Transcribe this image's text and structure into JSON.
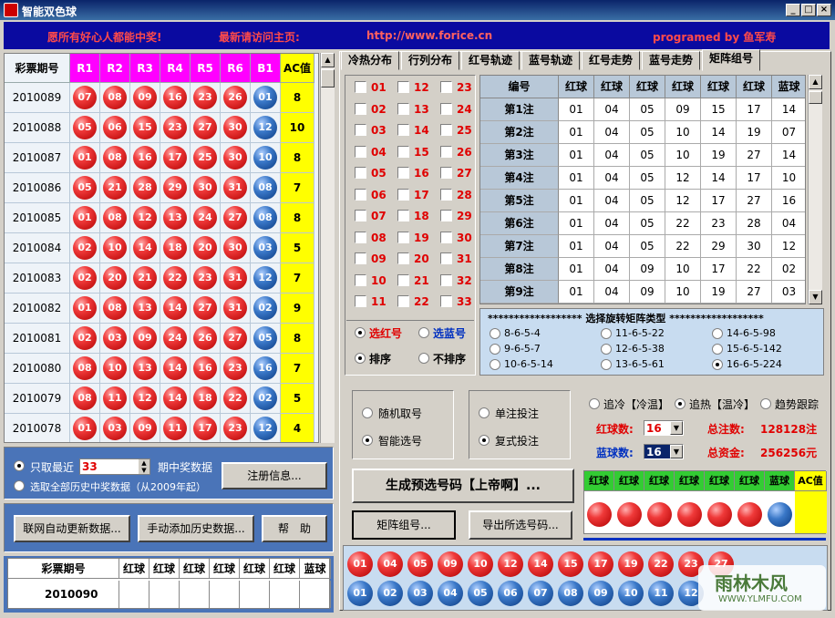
{
  "window": {
    "title": "智能双色球"
  },
  "banner": {
    "msg1": "愿所有好心人都能中奖!",
    "msg2": "最新请访问主页:",
    "url": "http://www.forice.cn",
    "author": "programed by 鱼军寿"
  },
  "history": {
    "headers": [
      "彩票期号",
      "R1",
      "R2",
      "R3",
      "R4",
      "R5",
      "R6",
      "B1",
      "AC值"
    ],
    "rows": [
      {
        "issue": "2010089",
        "reds": [
          "07",
          "08",
          "09",
          "16",
          "23",
          "26"
        ],
        "blue": "01",
        "ac": "8"
      },
      {
        "issue": "2010088",
        "reds": [
          "05",
          "06",
          "15",
          "23",
          "27",
          "30"
        ],
        "blue": "12",
        "ac": "10"
      },
      {
        "issue": "2010087",
        "reds": [
          "01",
          "08",
          "16",
          "17",
          "25",
          "30"
        ],
        "blue": "10",
        "ac": "8"
      },
      {
        "issue": "2010086",
        "reds": [
          "05",
          "21",
          "28",
          "29",
          "30",
          "31"
        ],
        "blue": "08",
        "ac": "7"
      },
      {
        "issue": "2010085",
        "reds": [
          "01",
          "08",
          "12",
          "13",
          "24",
          "27"
        ],
        "blue": "08",
        "ac": "8"
      },
      {
        "issue": "2010084",
        "reds": [
          "02",
          "10",
          "14",
          "18",
          "20",
          "30"
        ],
        "blue": "03",
        "ac": "5"
      },
      {
        "issue": "2010083",
        "reds": [
          "02",
          "20",
          "21",
          "22",
          "23",
          "31"
        ],
        "blue": "12",
        "ac": "7"
      },
      {
        "issue": "2010082",
        "reds": [
          "01",
          "08",
          "13",
          "14",
          "27",
          "31"
        ],
        "blue": "02",
        "ac": "9"
      },
      {
        "issue": "2010081",
        "reds": [
          "02",
          "03",
          "09",
          "24",
          "26",
          "27"
        ],
        "blue": "05",
        "ac": "8"
      },
      {
        "issue": "2010080",
        "reds": [
          "08",
          "10",
          "13",
          "14",
          "16",
          "23"
        ],
        "blue": "16",
        "ac": "7"
      },
      {
        "issue": "2010079",
        "reds": [
          "08",
          "11",
          "12",
          "14",
          "18",
          "22"
        ],
        "blue": "02",
        "ac": "5"
      },
      {
        "issue": "2010078",
        "reds": [
          "01",
          "03",
          "09",
          "11",
          "17",
          "23"
        ],
        "blue": "12",
        "ac": "4"
      }
    ]
  },
  "filter": {
    "recent_label": "只取最近",
    "recent_value": "33",
    "recent_suffix": "期中奖数据",
    "all_label": "选取全部历史中奖数据（从2009年起）",
    "register": "注册信息..."
  },
  "buttons": {
    "auto_update": "联网自动更新数据...",
    "manual_add": "手动添加历史数据...",
    "help": "帮　助",
    "generate": "生成预选号码【上帝啊】...",
    "matrix": "矩阵组号...",
    "export": "导出所选号码..."
  },
  "bottom_table": {
    "headers": [
      "彩票期号",
      "红球",
      "红球",
      "红球",
      "红球",
      "红球",
      "红球",
      "蓝球"
    ],
    "issue": "2010090"
  },
  "tabs": [
    "冷热分布",
    "行列分布",
    "红号轨迹",
    "蓝号轨迹",
    "红号走势",
    "蓝号走势",
    "矩阵组号"
  ],
  "checkbox_numbers": [
    "01",
    "12",
    "23",
    "02",
    "13",
    "24",
    "03",
    "14",
    "25",
    "04",
    "15",
    "26",
    "05",
    "16",
    "27",
    "06",
    "17",
    "28",
    "07",
    "18",
    "29",
    "08",
    "19",
    "30",
    "09",
    "20",
    "31",
    "10",
    "21",
    "32",
    "11",
    "22",
    "33"
  ],
  "select": {
    "red": "选红号",
    "blue": "选蓝号",
    "sort": "排序",
    "nosort": "不排序"
  },
  "matrix_table": {
    "headers": [
      "编号",
      "红球",
      "红球",
      "红球",
      "红球",
      "红球",
      "红球",
      "蓝球"
    ],
    "rows": [
      [
        "第1注",
        "01",
        "04",
        "05",
        "09",
        "15",
        "17",
        "14"
      ],
      [
        "第2注",
        "01",
        "04",
        "05",
        "10",
        "14",
        "19",
        "07"
      ],
      [
        "第3注",
        "01",
        "04",
        "05",
        "10",
        "19",
        "27",
        "14"
      ],
      [
        "第4注",
        "01",
        "04",
        "05",
        "12",
        "14",
        "17",
        "10"
      ],
      [
        "第5注",
        "01",
        "04",
        "05",
        "12",
        "17",
        "27",
        "16"
      ],
      [
        "第6注",
        "01",
        "04",
        "05",
        "22",
        "23",
        "28",
        "04"
      ],
      [
        "第7注",
        "01",
        "04",
        "05",
        "22",
        "29",
        "30",
        "12"
      ],
      [
        "第8注",
        "01",
        "04",
        "09",
        "10",
        "17",
        "22",
        "02"
      ],
      [
        "第9注",
        "01",
        "04",
        "09",
        "10",
        "19",
        "27",
        "03"
      ]
    ]
  },
  "matrix_types": {
    "title": "****************** 选择旋转矩阵类型 ******************",
    "options": [
      "8-6-5-4",
      "11-6-5-22",
      "14-6-5-98",
      "9-6-5-7",
      "12-6-5-38",
      "15-6-5-142",
      "10-6-5-14",
      "13-6-5-61",
      "16-6-5-224"
    ]
  },
  "mode": {
    "random": "随机取号",
    "smart": "智能选号",
    "single": "单注投注",
    "multi": "复式投注"
  },
  "trend": {
    "cold": "追冷【冷温】",
    "hot": "追热【温冷】",
    "track": "趋势跟踪"
  },
  "counts": {
    "red_label": "红球数:",
    "red_value": "16",
    "blue_label": "蓝球数:",
    "blue_value": "16",
    "total_label": "总注数:",
    "total_value": "128128注",
    "money_label": "总资金:",
    "money_value": "256256元"
  },
  "result_headers": [
    "红球",
    "红球",
    "红球",
    "红球",
    "红球",
    "红球",
    "蓝球",
    "AC值"
  ],
  "pool_red": [
    "01",
    "04",
    "05",
    "09",
    "10",
    "12",
    "14",
    "15",
    "17",
    "19",
    "22",
    "23",
    "27"
  ],
  "pool_blue": [
    "01",
    "02",
    "03",
    "04",
    "05",
    "06",
    "07",
    "08",
    "09",
    "10",
    "11",
    "12"
  ],
  "watermark": {
    "text": "雨林木风",
    "url": "WWW.YLMFU.COM"
  }
}
